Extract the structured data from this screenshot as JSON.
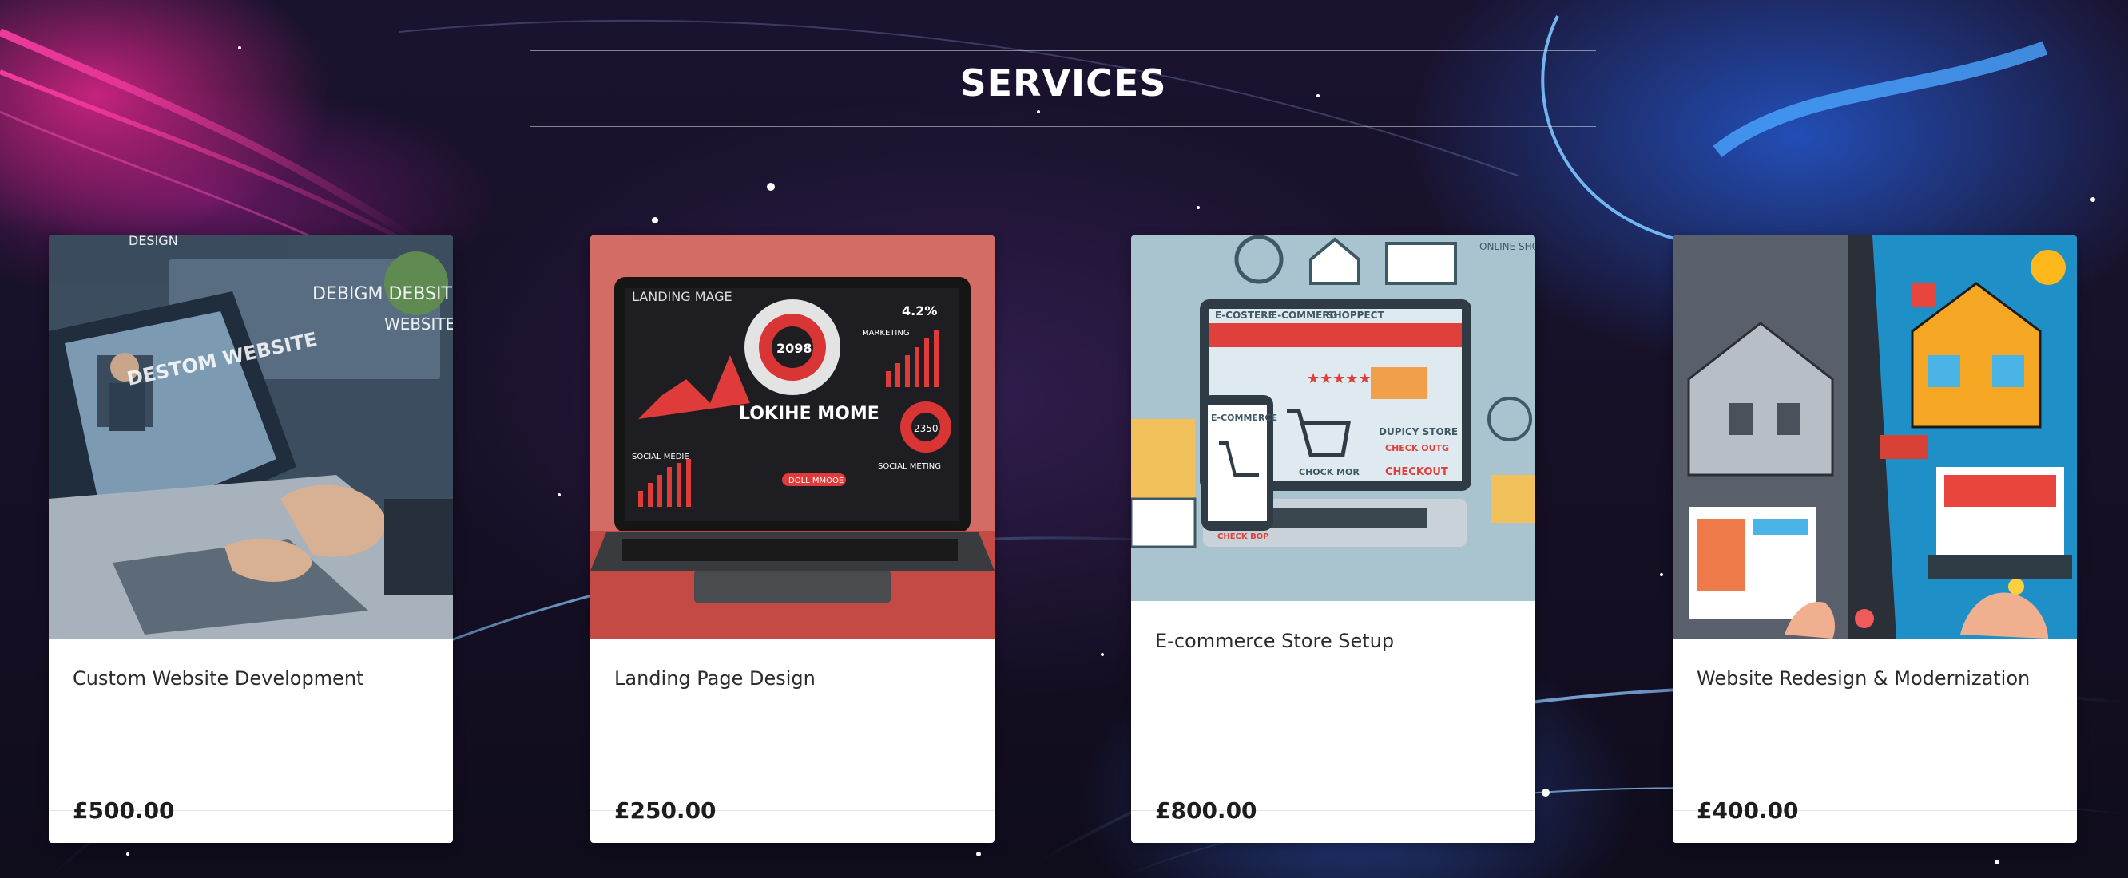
{
  "section": {
    "title": "SERVICES"
  },
  "services": [
    {
      "name": "Custom Website Development",
      "price": "£500.00",
      "image_text": {
        "screen_title": "DESTOM WEBSITE",
        "panel_1": "DEBIGM DEBSITE",
        "panel_2": "WEBSITE",
        "corner": "DESIGN"
      }
    },
    {
      "name": "Landing Page Design",
      "price": "£250.00",
      "image_text": {
        "heading": "LANDING MAGE",
        "center_value": "2098",
        "stat": "4.2%",
        "marketing": "MARKETING",
        "headline": "LOKIHE MOME",
        "ring_value": "2350",
        "social_media": "SOCIAL MEDIE",
        "social_meeting": "SOCIAL METING",
        "button": "DOLL MMOOE"
      }
    },
    {
      "name": "E-commerce Store Setup",
      "price": "£800.00",
      "image_text": {
        "nav_1": "E-COSTERE",
        "nav_2": "E-COMMERG",
        "nav_3": "SHOPPECT",
        "online": "ONLINE SHOPPE",
        "phone_label": "E-COMMERCE",
        "phone_button": "CHECK BOP",
        "laptop_button": "CHOCK MOR",
        "store_label": "DUPICY STORE",
        "store_link": "CHECK OUTG",
        "checkout": "CHECKOUT",
        "stars": "★★★★★"
      }
    },
    {
      "name": "Website Redesign & Modernization",
      "price": "£400.00",
      "image_text": {}
    }
  ]
}
